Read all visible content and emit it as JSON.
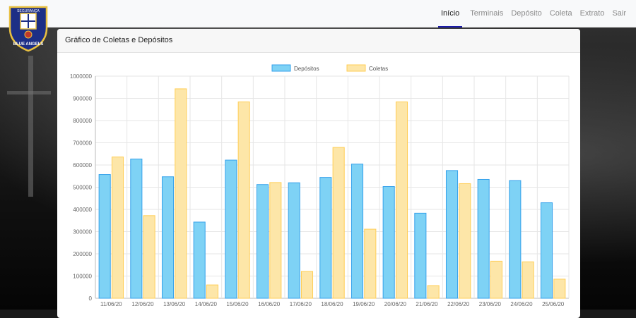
{
  "navbar": {
    "logo_text_top": "SEGURANÇA",
    "logo_text_bottom": "BLUE ANGELS",
    "items": [
      {
        "label": "Início",
        "active": true
      },
      {
        "label": "Terminais",
        "active": false
      },
      {
        "label": "Depósito",
        "active": false
      },
      {
        "label": "Coleta",
        "active": false
      },
      {
        "label": "Extrato",
        "active": false
      },
      {
        "label": "Sair",
        "active": false
      }
    ]
  },
  "card": {
    "title": "Gráfico de Coletas e Depósitos"
  },
  "colors": {
    "depositos_fill": "#7ed2f5",
    "depositos_stroke": "#36a2eb",
    "coletas_fill": "#fde6a8",
    "coletas_stroke": "#ffce56",
    "nav_active_border": "#1a1aa8"
  },
  "chart_data": {
    "type": "bar",
    "categories": [
      "11/06/20",
      "12/06/20",
      "13/06/20",
      "14/06/20",
      "15/06/20",
      "16/06/20",
      "17/06/20",
      "18/06/20",
      "19/06/20",
      "20/06/20",
      "21/06/20",
      "22/06/20",
      "23/06/20",
      "24/06/20",
      "25/06/20"
    ],
    "series": [
      {
        "name": "Depósitos",
        "values": [
          557000,
          627000,
          547000,
          343000,
          622000,
          512000,
          520000,
          544000,
          604000,
          503000,
          383000,
          575000,
          535000,
          530000,
          430000
        ]
      },
      {
        "name": "Coletas",
        "values": [
          636000,
          372000,
          943000,
          60000,
          884000,
          521000,
          121000,
          679000,
          311000,
          884000,
          57000,
          516000,
          167000,
          164000,
          86000
        ]
      }
    ],
    "yticks": [
      0,
      100000,
      200000,
      300000,
      400000,
      500000,
      600000,
      700000,
      800000,
      900000,
      1000000
    ],
    "ylim": [
      0,
      1000000
    ],
    "grid": true,
    "legend": "top-center"
  }
}
